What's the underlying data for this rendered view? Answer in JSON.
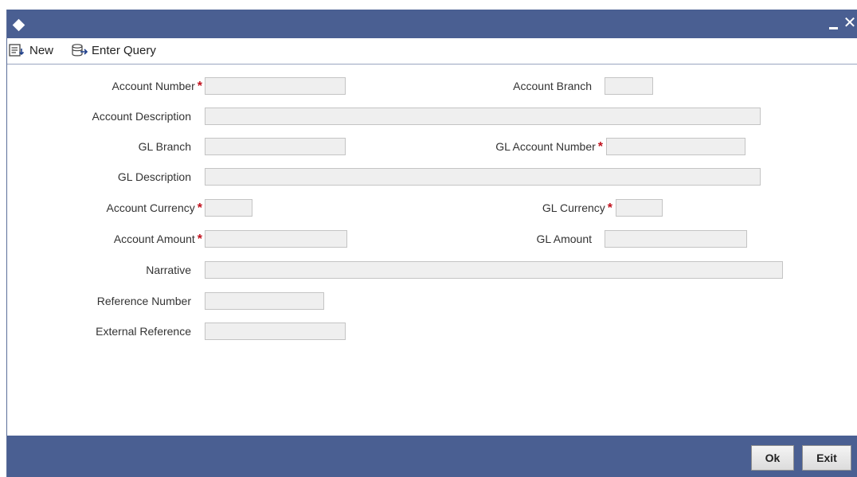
{
  "window": {
    "title": "",
    "window_icon": "diamond-icon",
    "minimize_icon": "minimize-icon",
    "close_icon": "close-icon",
    "close_glyph": "✕"
  },
  "toolbar": {
    "new_label": "New",
    "new_icon": "new-record-icon",
    "enter_query_label": "Enter Query",
    "enter_query_icon": "enter-query-icon"
  },
  "form": {
    "account_number": {
      "label": "Account Number",
      "required": "*",
      "value": ""
    },
    "account_branch": {
      "label": "Account Branch",
      "value": ""
    },
    "account_description": {
      "label": "Account Description",
      "value": ""
    },
    "gl_branch": {
      "label": "GL Branch",
      "value": ""
    },
    "gl_account_number": {
      "label": "GL Account Number",
      "required": "*",
      "value": ""
    },
    "gl_description": {
      "label": "GL Description",
      "value": ""
    },
    "account_currency": {
      "label": "Account Currency",
      "required": "*",
      "value": ""
    },
    "gl_currency": {
      "label": "GL Currency",
      "required": "*",
      "value": ""
    },
    "account_amount": {
      "label": "Account Amount",
      "required": "*",
      "value": ""
    },
    "gl_amount": {
      "label": "GL Amount",
      "value": ""
    },
    "narrative": {
      "label": "Narrative",
      "value": ""
    },
    "reference_number": {
      "label": "Reference Number",
      "value": ""
    },
    "external_reference": {
      "label": "External Reference",
      "value": ""
    }
  },
  "footer": {
    "ok_label": "Ok",
    "exit_label": "Exit"
  },
  "colors": {
    "titlebar": "#4a5f92",
    "required_marker": "#c0101c",
    "input_bg": "#efefef"
  }
}
